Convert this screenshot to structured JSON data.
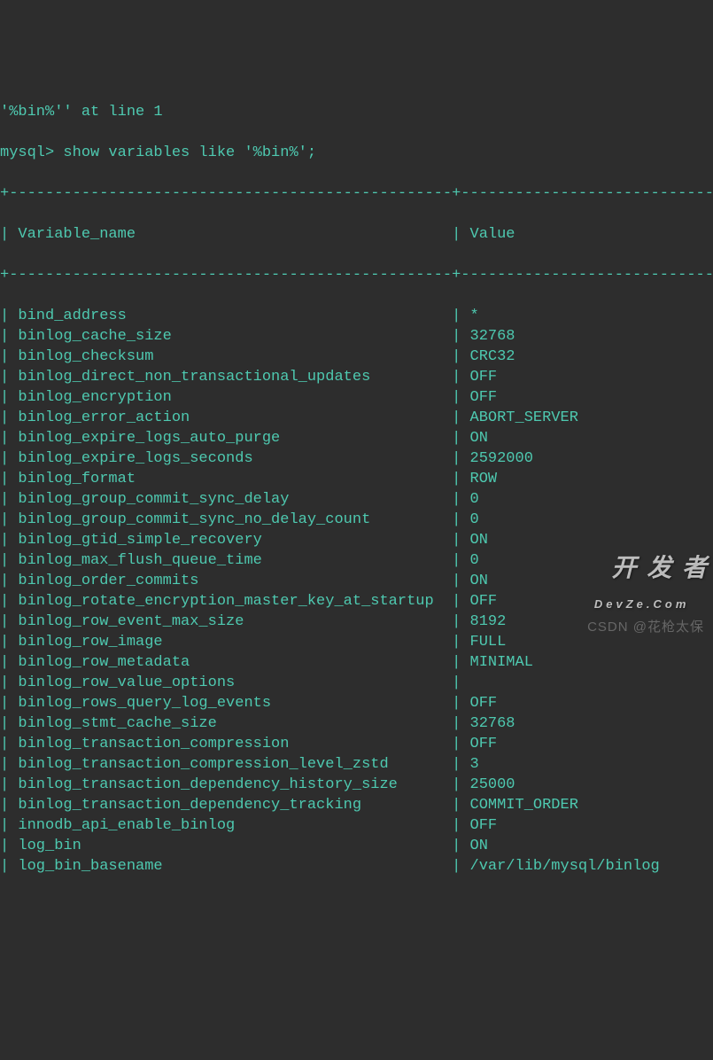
{
  "header": {
    "error_line": "'%bin%'' at line 1",
    "prompt": "mysql> show variables like '%bin%';"
  },
  "table": {
    "separator_top": "+-------------------------------------------------+------------------------------",
    "header_row": "| Variable_name                                   | Value                        |",
    "separator_mid": "+-------------------------------------------------+------------------------------",
    "columns": [
      "Variable_name",
      "Value"
    ],
    "rows": [
      {
        "name": "bind_address",
        "value": "*"
      },
      {
        "name": "binlog_cache_size",
        "value": "32768"
      },
      {
        "name": "binlog_checksum",
        "value": "CRC32"
      },
      {
        "name": "binlog_direct_non_transactional_updates",
        "value": "OFF"
      },
      {
        "name": "binlog_encryption",
        "value": "OFF"
      },
      {
        "name": "binlog_error_action",
        "value": "ABORT_SERVER"
      },
      {
        "name": "binlog_expire_logs_auto_purge",
        "value": "ON"
      },
      {
        "name": "binlog_expire_logs_seconds",
        "value": "2592000"
      },
      {
        "name": "binlog_format",
        "value": "ROW"
      },
      {
        "name": "binlog_group_commit_sync_delay",
        "value": "0"
      },
      {
        "name": "binlog_group_commit_sync_no_delay_count",
        "value": "0"
      },
      {
        "name": "binlog_gtid_simple_recovery",
        "value": "ON"
      },
      {
        "name": "binlog_max_flush_queue_time",
        "value": "0"
      },
      {
        "name": "binlog_order_commits",
        "value": "ON"
      },
      {
        "name": "binlog_rotate_encryption_master_key_at_startup",
        "value": "OFF"
      },
      {
        "name": "binlog_row_event_max_size",
        "value": "8192"
      },
      {
        "name": "binlog_row_image",
        "value": "FULL"
      },
      {
        "name": "binlog_row_metadata",
        "value": "MINIMAL"
      },
      {
        "name": "binlog_row_value_options",
        "value": ""
      },
      {
        "name": "binlog_rows_query_log_events",
        "value": "OFF"
      },
      {
        "name": "binlog_stmt_cache_size",
        "value": "32768"
      },
      {
        "name": "binlog_transaction_compression",
        "value": "OFF"
      },
      {
        "name": "binlog_transaction_compression_level_zstd",
        "value": "3"
      },
      {
        "name": "binlog_transaction_dependency_history_size",
        "value": "25000"
      },
      {
        "name": "binlog_transaction_dependency_tracking",
        "value": "COMMIT_ORDER"
      },
      {
        "name": "innodb_api_enable_binlog",
        "value": "OFF"
      },
      {
        "name": "log_bin",
        "value": "ON"
      },
      {
        "name": "log_bin_basename",
        "value": "/var/lib/mysql/binlog"
      }
    ]
  },
  "watermarks": {
    "csdn": "CSDN @花枪太保",
    "dev_main": "开 发 者",
    "dev_sub": "DevZe.Com"
  }
}
